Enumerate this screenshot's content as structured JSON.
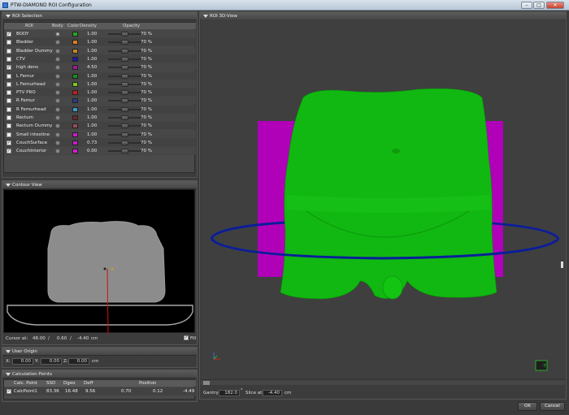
{
  "window": {
    "title": "PTW-DIAMOND ROI Configuration"
  },
  "roi_panel": {
    "title": "ROI Selection",
    "columns": {
      "roi": "ROI",
      "body": "Body",
      "color": "Color",
      "density": "Density",
      "opacity": "Opacity"
    },
    "rows": [
      {
        "name": "BODY",
        "checked": true,
        "body": true,
        "color": "#1fa81f",
        "density": "1.00",
        "opacity": "70 %"
      },
      {
        "name": "Bladder",
        "checked": false,
        "body": false,
        "color": "#e07a1a",
        "density": "1.00",
        "opacity": "70 %"
      },
      {
        "name": "Bladder Dummy",
        "checked": false,
        "body": false,
        "color": "#c8822a",
        "density": "1.00",
        "opacity": "70 %"
      },
      {
        "name": "CTV",
        "checked": false,
        "body": false,
        "color": "#1a1aa8",
        "density": "1.00",
        "opacity": "70 %"
      },
      {
        "name": "high dens",
        "checked": true,
        "body": false,
        "color": "#9a1a9a",
        "density": "4.50",
        "opacity": "70 %"
      },
      {
        "name": "L Femur",
        "checked": false,
        "body": false,
        "color": "#1a8a1a",
        "density": "1.00",
        "opacity": "70 %"
      },
      {
        "name": "L Femurhead",
        "checked": false,
        "body": false,
        "color": "#7ac81a",
        "density": "1.00",
        "opacity": "70 %"
      },
      {
        "name": "PTV PRO",
        "checked": false,
        "body": false,
        "color": "#c81a1a",
        "density": "1.00",
        "opacity": "70 %"
      },
      {
        "name": "R Femur",
        "checked": false,
        "body": false,
        "color": "#2a3a8a",
        "density": "1.00",
        "opacity": "70 %"
      },
      {
        "name": "R Femurhead",
        "checked": false,
        "body": false,
        "color": "#3a9ac8",
        "density": "1.00",
        "opacity": "70 %"
      },
      {
        "name": "Rectum",
        "checked": false,
        "body": false,
        "color": "#6a2a2a",
        "density": "1.00",
        "opacity": "70 %"
      },
      {
        "name": "Rectum  Dummy",
        "checked": false,
        "body": false,
        "color": "#9a4a5a",
        "density": "1.00",
        "opacity": "70 %"
      },
      {
        "name": "Small intestine",
        "checked": false,
        "body": false,
        "color": "#c81ac8",
        "density": "1.00",
        "opacity": "70 %"
      },
      {
        "name": "CouchSurface",
        "checked": true,
        "body": false,
        "color": "#c81ac8",
        "density": "0.73",
        "opacity": "70 %"
      },
      {
        "name": "CouchInterior",
        "checked": true,
        "body": false,
        "color": "#d81ad8",
        "density": "0.00",
        "opacity": "70 %"
      }
    ]
  },
  "contour_panel": {
    "title": "Contour View",
    "cursor_label": "Cursor at:",
    "cursor_x": "48.00",
    "sep1": "/",
    "cursor_y": "0.60",
    "sep2": "/",
    "cursor_z": "-4.40",
    "unit": "cm",
    "fill_label": "Fill",
    "fill_checked": true
  },
  "user_origin": {
    "title": "User Origin",
    "x_label": "X:",
    "x": "0.00",
    "y_label": "Y:",
    "y": "0.00",
    "z_label": "Z:",
    "z": "0.00",
    "unit": "cm"
  },
  "calc_points": {
    "title": "Calculation Points",
    "headers": {
      "name": "Calc. Point",
      "ssd": "SSD",
      "dgeo": "Dgeo",
      "deff": "Deff",
      "position": "Position"
    },
    "rows": [
      {
        "checked": true,
        "name": "CalcPoint1",
        "ssd": "83.36",
        "dgeo": "16.48",
        "deff": "9.56",
        "px": "0.70",
        "py": "0.12",
        "pz": "-4.49"
      }
    ]
  },
  "view3d": {
    "title": "ROI 3D-View",
    "axis_label": "-Y",
    "gantry_label": "Gantry:",
    "gantry_value": "182.0",
    "gantry_unit": "°",
    "slice_label": "Slice at:",
    "slice_value": "-4.40",
    "slice_unit": "cm"
  },
  "footer": {
    "ok_label": "OK",
    "cancel_label": "Cancel"
  },
  "colors": {
    "body_green": "#11b811",
    "couch_magenta": "#b000b8",
    "ring_blue": "#0a1e9a",
    "viewport_bg": "#3f3f3f"
  }
}
